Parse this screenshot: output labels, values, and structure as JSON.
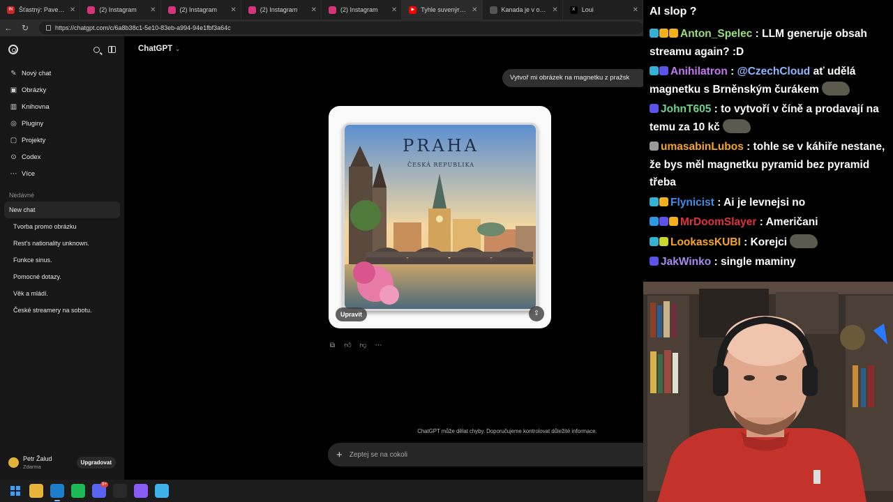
{
  "browser": {
    "tabs": [
      {
        "title": "Šťastný: Pavel je lídr opo",
        "color": "#c62828",
        "fav": "IN"
      },
      {
        "title": "(2) Instagram",
        "color": "#d6337a",
        "fav": ""
      },
      {
        "title": "(2) Instagram",
        "color": "#d6337a",
        "fav": ""
      },
      {
        "title": "(2) Instagram",
        "color": "#d6337a",
        "fav": ""
      },
      {
        "title": "(2) Instagram",
        "color": "#d6337a",
        "fav": ""
      },
      {
        "title": "Tyhle suvenýry jsou teď",
        "color": "#ff0000",
        "fav": "▶"
      },
      {
        "title": "Kanada je v obchodní vá",
        "color": "#555555",
        "fav": ""
      },
      {
        "title": "Loui",
        "color": "#000000",
        "fav": "X"
      }
    ],
    "url": "https://chatgpt.com/c/6a8b38c1-5e10-83eb-a994-94e1fbf3a64c"
  },
  "sidebar": {
    "menu": [
      {
        "label": "Nový chat",
        "icon": "✎",
        "name": "new-chat"
      },
      {
        "label": "Obrázky",
        "icon": "▣",
        "name": "images"
      },
      {
        "label": "Knihovna",
        "icon": "▥",
        "name": "library"
      },
      {
        "label": "Pluginy",
        "icon": "◎",
        "name": "plugins"
      },
      {
        "label": "Projekty",
        "icon": "▢",
        "name": "projects"
      },
      {
        "label": "Codex",
        "icon": "⊙",
        "name": "codex"
      },
      {
        "label": "Více",
        "icon": "⋯",
        "name": "more"
      }
    ],
    "recent_label": "Nedávné",
    "recent": [
      "New chat",
      "Tvorba promo obrázku",
      "Rest's nationality unknown.",
      "Funkce sinus.",
      "Pomocné dotazy.",
      "Věk a mládí.",
      "České streamery na sobotu."
    ],
    "user": {
      "name": "Petr Žalud",
      "plan": "Zdarma",
      "upgrade_label": "Upgradovat"
    }
  },
  "main": {
    "model_label": "ChatGPT",
    "user_message": "Vytvoř mi obrázek na magnetku z pražsk",
    "image": {
      "title": "PRAHA",
      "subtitle": "ČESKÁ REPUBLIKA",
      "edit_label": "Upravit"
    },
    "disclaimer": "ChatGPT může dělat chyby. Doporučujeme kontrolovat důležité informace.",
    "composer_placeholder": "Zeptej se na cokoli"
  },
  "stream_chat": {
    "title": "AI slop ?",
    "messages": [
      {
        "user": "Anton_Spelec",
        "color": "#9be07a",
        "badges": [
          "#35b1d6",
          "#f2b01e",
          "#f2b01e"
        ],
        "text": "LLM generuje obsah streamu again? :D",
        "emote": false
      },
      {
        "user": "Anihilatron",
        "color": "#c479f2",
        "badges": [
          "#35b1d6",
          "#5a54e8"
        ],
        "mention": "@CzechCloud",
        "text": "ať udělá magnetku s Brněnským čurákem",
        "emote": true
      },
      {
        "user": "JohnT605",
        "color": "#6fd48b",
        "badges": [
          "#5a54e8"
        ],
        "text": "to vytvoří v číně a prodavají na temu za 10 kč",
        "emote": true
      },
      {
        "user": "umasabinLubos",
        "color": "#f5a623",
        "badges": [
          "#9a9a9a"
        ],
        "text": "tohle se v káhiře nestane, že bys měl magnetku pyramid bez pyramid třeba",
        "emote": false
      },
      {
        "user": "Flynicist",
        "color": "#3f8fe8",
        "badges": [
          "#35b1d6",
          "#f2b01e"
        ],
        "text": "Ai je levnejsi no",
        "emote": false
      },
      {
        "user": "MrDoomSlayer",
        "color": "#e0323a",
        "badges": [
          "#2c9ae0",
          "#5a54e8",
          "#f2b01e"
        ],
        "text": "Američani",
        "emote": false
      },
      {
        "user": "LookassKUBI",
        "color": "#f5a623",
        "badges": [
          "#35b1d6",
          "#c8d62f"
        ],
        "text": "Korejci",
        "emote": true
      },
      {
        "user": "JakWinko",
        "color": "#a58cf0",
        "badges": [
          "#5a54e8"
        ],
        "text": "single maminy",
        "emote": false
      }
    ]
  },
  "taskbar": {
    "apps": [
      {
        "name": "windows-start",
        "color": "#1c1c1c"
      },
      {
        "name": "file-explorer",
        "color": "#e8b33a"
      },
      {
        "name": "edge-browser",
        "color": "#1e7fc8"
      },
      {
        "name": "spotify",
        "color": "#1db954"
      },
      {
        "name": "discord",
        "color": "#5865f2"
      },
      {
        "name": "obs",
        "color": "#2a2a2a"
      },
      {
        "name": "copilot",
        "color": "#8a5cf6"
      },
      {
        "name": "notepad",
        "color": "#3db1e8"
      }
    ]
  }
}
